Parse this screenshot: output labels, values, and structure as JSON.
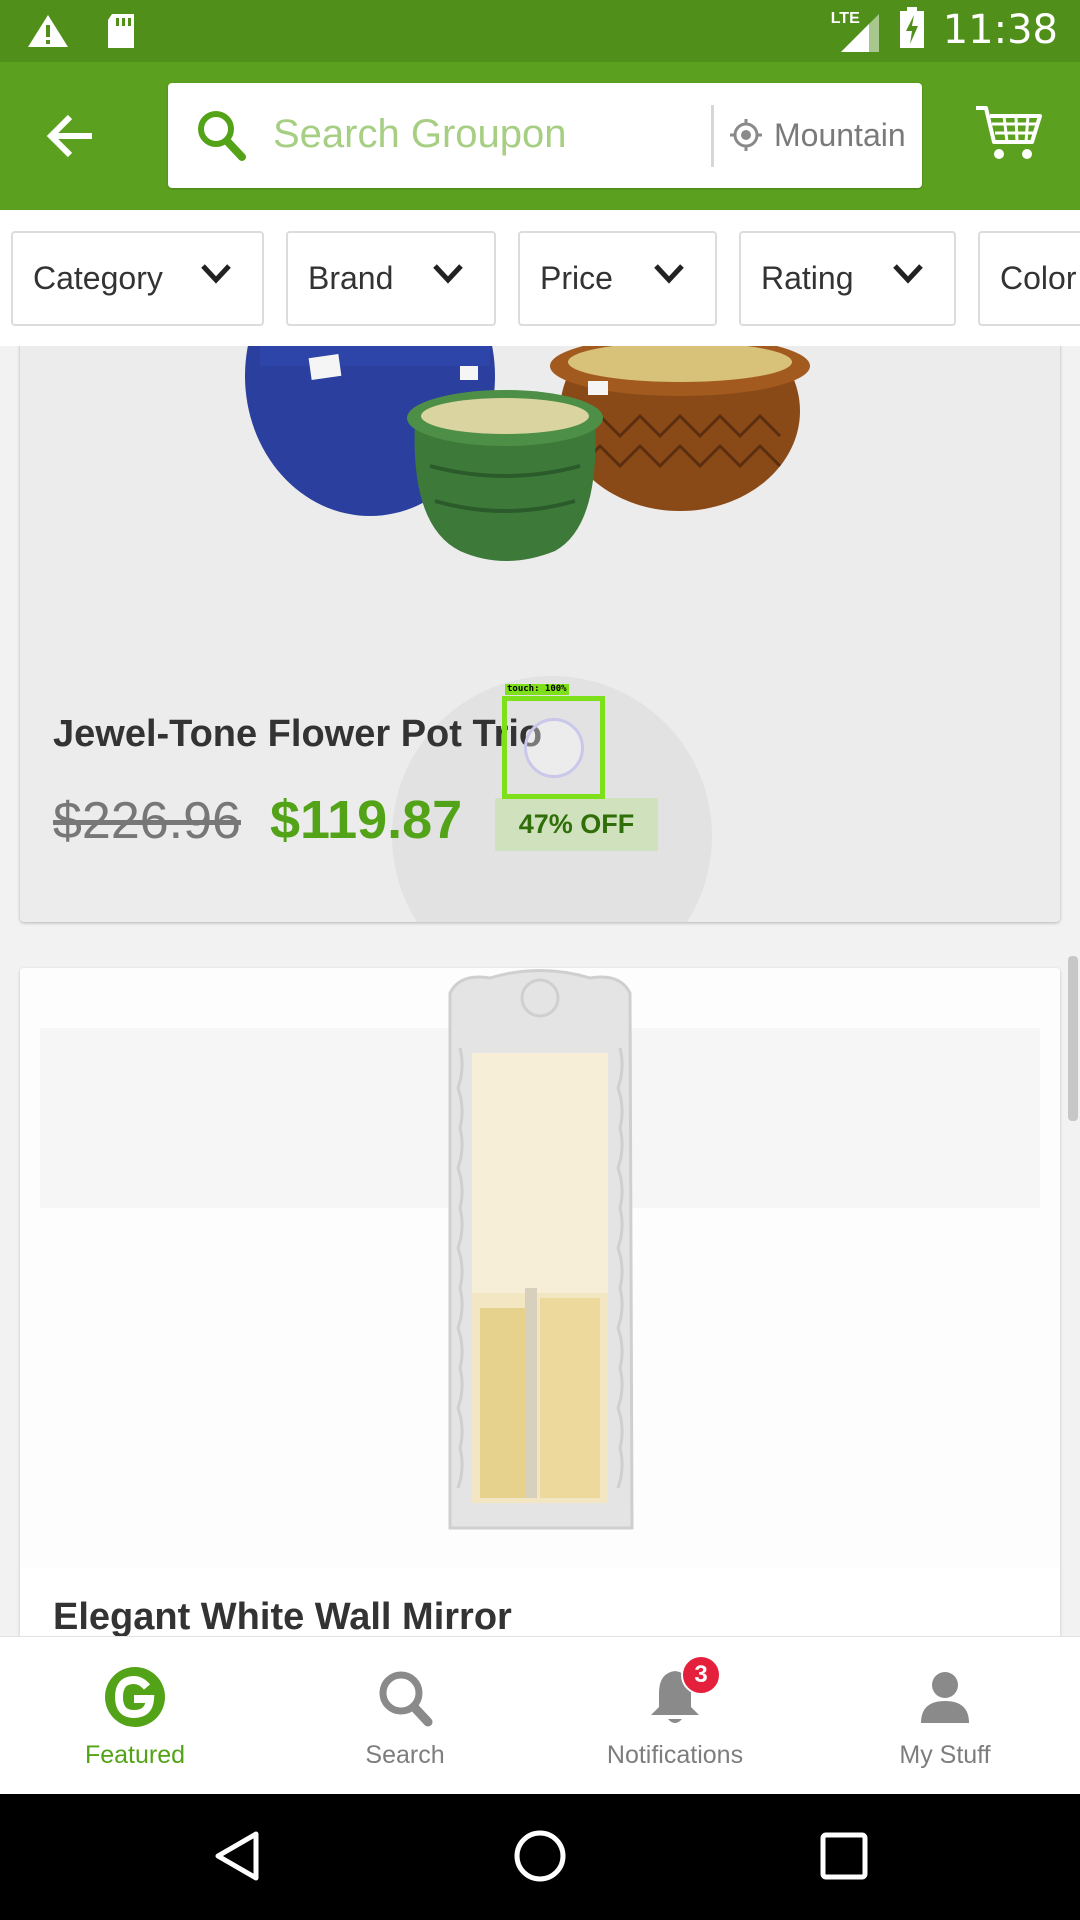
{
  "status_bar": {
    "time": "11:38",
    "network": "LTE",
    "icons": [
      "warning-icon",
      "sd-card-icon",
      "signal-icon",
      "battery-charging-icon"
    ]
  },
  "toolbar": {
    "search_placeholder": "Search Groupon",
    "location": "Mountain",
    "colors": {
      "status_bar": "#4f8f1a",
      "toolbar": "#5ba11f",
      "accent": "#53a318"
    }
  },
  "filters": [
    {
      "label": "Category"
    },
    {
      "label": "Brand"
    },
    {
      "label": "Price"
    },
    {
      "label": "Rating"
    },
    {
      "label": "Color"
    }
  ],
  "products": [
    {
      "title": "Jewel-Tone Flower Pot Trio",
      "old_price": "$226.96",
      "new_price": "$119.87",
      "discount": "47% OFF"
    },
    {
      "title": "Elegant White Wall Mirror"
    }
  ],
  "touch_overlay": {
    "label": "touch: 100%"
  },
  "bottom_nav": {
    "items": [
      {
        "label": "Featured",
        "icon": "groupon-g-icon",
        "active": true
      },
      {
        "label": "Search",
        "icon": "search-icon"
      },
      {
        "label": "Notifications",
        "icon": "bell-icon",
        "badge": "3"
      },
      {
        "label": "My Stuff",
        "icon": "person-icon"
      }
    ]
  }
}
